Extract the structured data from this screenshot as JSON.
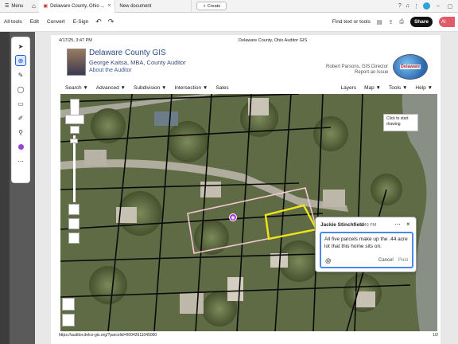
{
  "topbar": {
    "menu_label": "Menu",
    "tabs": [
      {
        "label": "Delaware County, Ohio ..."
      },
      {
        "label": "New document"
      }
    ],
    "create_label": "Create"
  },
  "toolbar": {
    "items": [
      "All tools",
      "Edit",
      "Convert",
      "E-Sign"
    ],
    "find_label": "Find text or tools",
    "share_label": "Share",
    "ai_label": "AI"
  },
  "page": {
    "date": "4/17/25, 3:47 PM",
    "title": "Delaware County, Ohio Auditor GIS",
    "footer_url": "https://auditor.delco-gis.org/?parcelid=60042611045000",
    "page_num": "1/2"
  },
  "gis": {
    "title": "Delaware County GIS",
    "subtitle": "George Kaitsa, MBA, County Auditor",
    "about": "About the Auditor",
    "director": "Robert Parsons, GIS Director",
    "report": "Report an Issue",
    "logo_text": "Delaware",
    "nav_left": [
      "Search ▼",
      "Advanced ▼",
      "Subdivision ▼",
      "Intersection ▼",
      "Sales"
    ],
    "nav_right": [
      "Layers",
      "Map ▼",
      "Tools ▼",
      "Help ▼"
    ]
  },
  "map": {
    "tooltip": "Click to start drawing"
  },
  "comment": {
    "author": "Jackie Stinchfield",
    "time": "3:49 PM",
    "text": "All five parcels make up the .44 acre lot that this home sits on.",
    "cancel": "Cancel",
    "post": "Post"
  }
}
